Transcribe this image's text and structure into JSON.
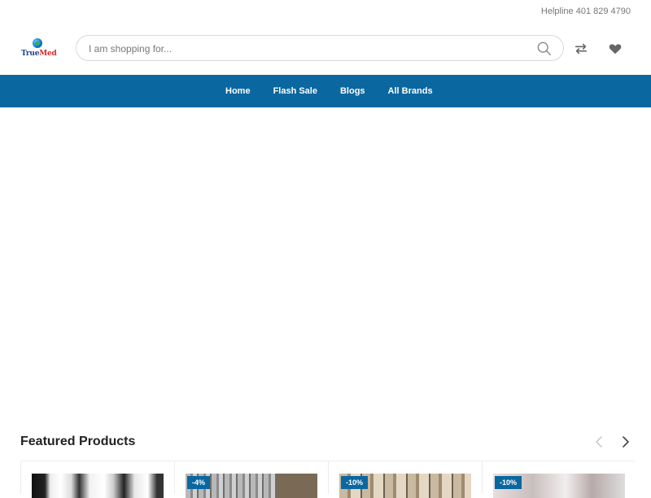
{
  "topbar": {
    "helpline": "Helpline 401 829 4790"
  },
  "brand": {
    "logo_text_a": "True",
    "logo_text_b": "Med"
  },
  "search": {
    "placeholder": "I am shopping for..."
  },
  "icons": {
    "search": "search-icon",
    "compare": "compare-icon",
    "wishlist": "heart-icon"
  },
  "colors": {
    "nav_bg": "#0a67a0",
    "badge_bg": "#0a67a0"
  },
  "nav": {
    "items": [
      {
        "label": "Home"
      },
      {
        "label": "Flash Sale"
      },
      {
        "label": "Blogs"
      },
      {
        "label": "All Brands"
      }
    ]
  },
  "featured": {
    "title": "Featured Products",
    "products": [
      {
        "badge": ""
      },
      {
        "badge": "-4%"
      },
      {
        "badge": "-10%"
      },
      {
        "badge": "-10%"
      }
    ]
  }
}
